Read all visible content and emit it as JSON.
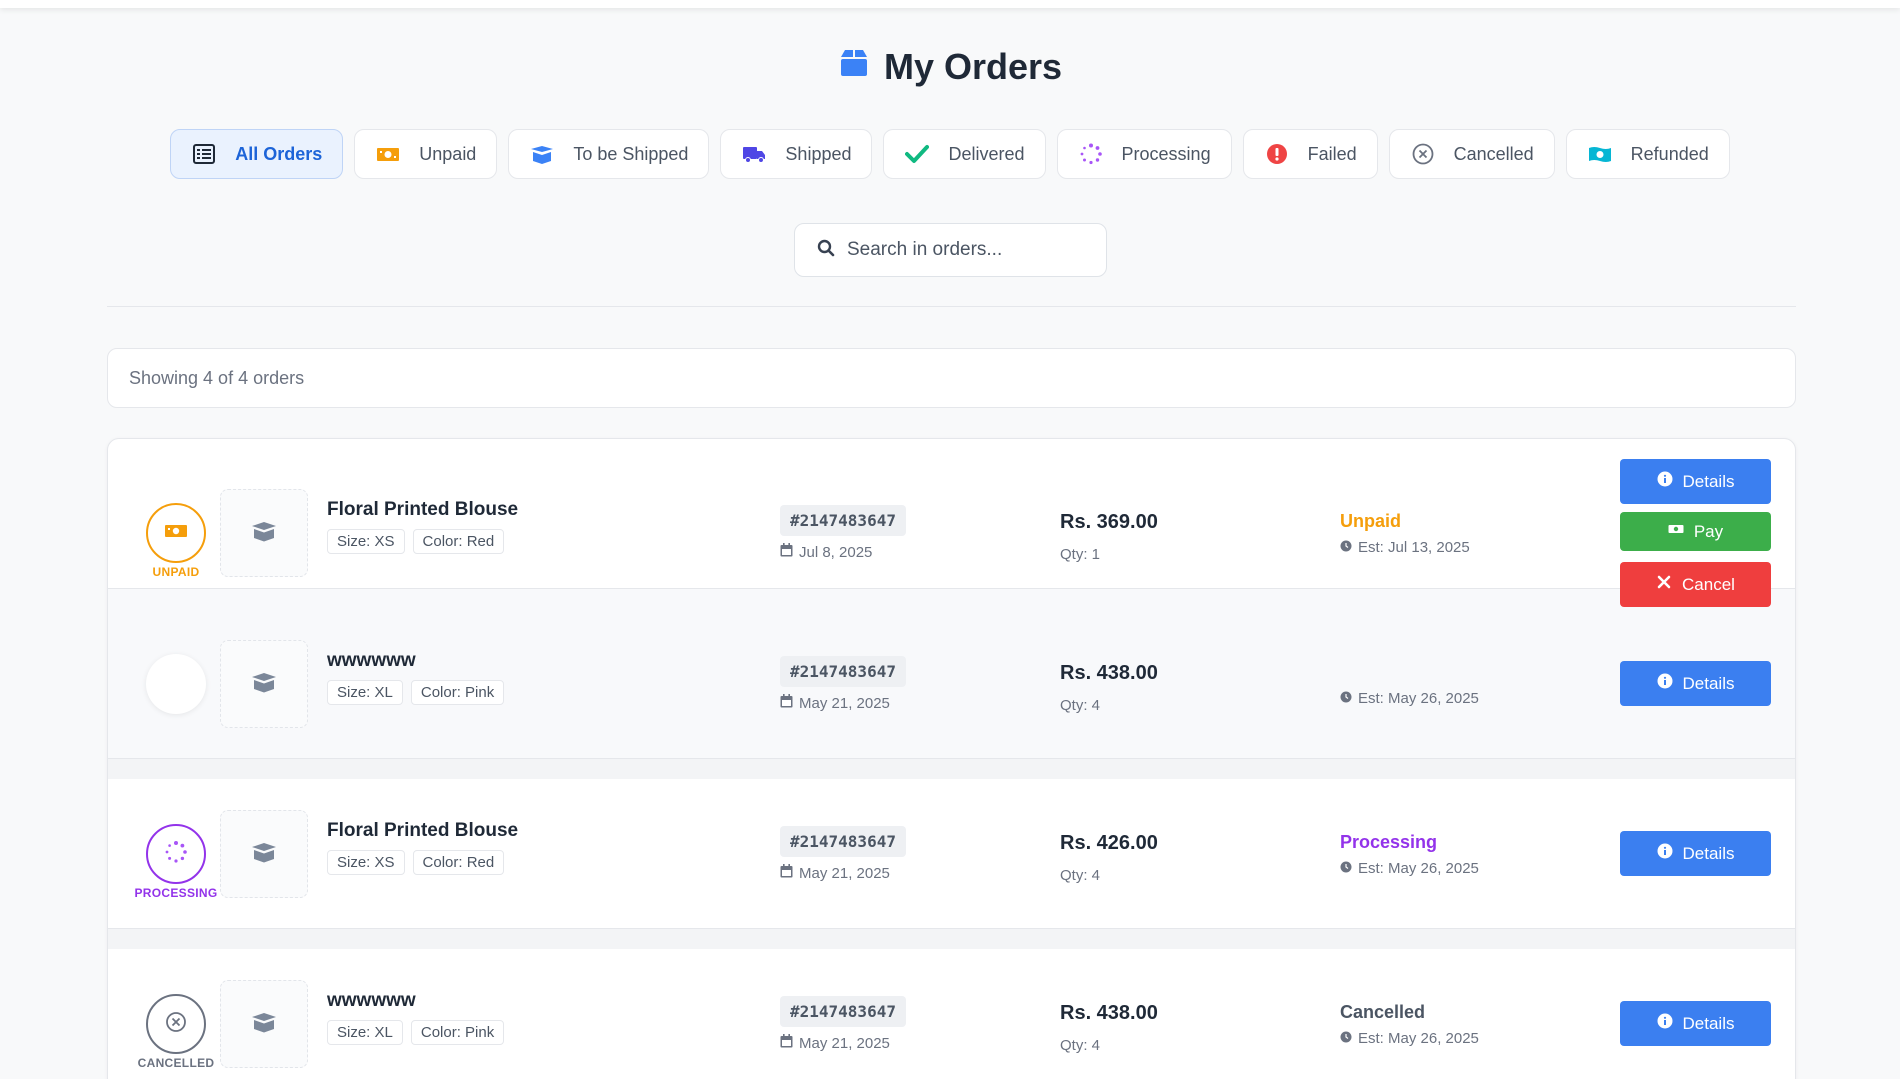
{
  "page": {
    "title": "My Orders"
  },
  "tabs": [
    {
      "label": "All Orders",
      "icon": "list-icon",
      "active": true
    },
    {
      "label": "Unpaid",
      "icon": "money-bill-icon"
    },
    {
      "label": "To be Shipped",
      "icon": "box-open-icon"
    },
    {
      "label": "Shipped",
      "icon": "truck-icon"
    },
    {
      "label": "Delivered",
      "icon": "check-icon"
    },
    {
      "label": "Processing",
      "icon": "spinner-icon"
    },
    {
      "label": "Failed",
      "icon": "exclamation-circle-icon"
    },
    {
      "label": "Cancelled",
      "icon": "times-circle-icon"
    },
    {
      "label": "Refunded",
      "icon": "money-bill-wave-icon"
    }
  ],
  "search": {
    "placeholder": "Search in orders...",
    "value": ""
  },
  "summary": {
    "text": "Showing 4 of 4 orders"
  },
  "orders": [
    {
      "badge": "UNPAID",
      "badge_color": "#f59e0b",
      "product": "Floral Printed Blouse",
      "size": "Size: XS",
      "color": "Color: Red",
      "order_id": "#2147483647",
      "date": "Jul 8, 2025",
      "price": "Rs. 369.00",
      "qty": "Qty: 1",
      "status": "Unpaid",
      "status_color": "#f59e0b",
      "est": "Est: Jul 13, 2025",
      "actions": {
        "details": "Details",
        "pay": "Pay",
        "cancel": "Cancel"
      }
    },
    {
      "badge": "",
      "badge_color": "#cccccc",
      "product": "wwwwww",
      "size": "Size: XL",
      "color": "Color: Pink",
      "order_id": "#2147483647",
      "date": "May 21, 2025",
      "price": "Rs. 438.00",
      "qty": "Qty: 4",
      "status": "",
      "est": "Est: May 26, 2025",
      "actions": {
        "details": "Details"
      }
    },
    {
      "badge": "PROCESSING",
      "badge_color": "#9333ea",
      "product": "Floral Printed Blouse",
      "size": "Size: XS",
      "color": "Color: Red",
      "order_id": "#2147483647",
      "date": "May 21, 2025",
      "price": "Rs. 426.00",
      "qty": "Qty: 4",
      "status": "Processing",
      "status_color": "#9333ea",
      "est": "Est: May 26, 2025",
      "actions": {
        "details": "Details"
      }
    },
    {
      "badge": "CANCELLED",
      "badge_color": "#6b7280",
      "product": "wwwwww",
      "size": "Size: XL",
      "color": "Color: Pink",
      "order_id": "#2147483647",
      "date": "May 21, 2025",
      "price": "Rs. 438.00",
      "qty": "Qty: 4",
      "status": "Cancelled",
      "status_color": "#4b5563",
      "est": "Est: May 26, 2025",
      "actions": {
        "details": "Details"
      }
    }
  ],
  "colors": {
    "accent": "#3b7ff0",
    "pay": "#3cae4a",
    "cancel": "#ef3e3e"
  }
}
